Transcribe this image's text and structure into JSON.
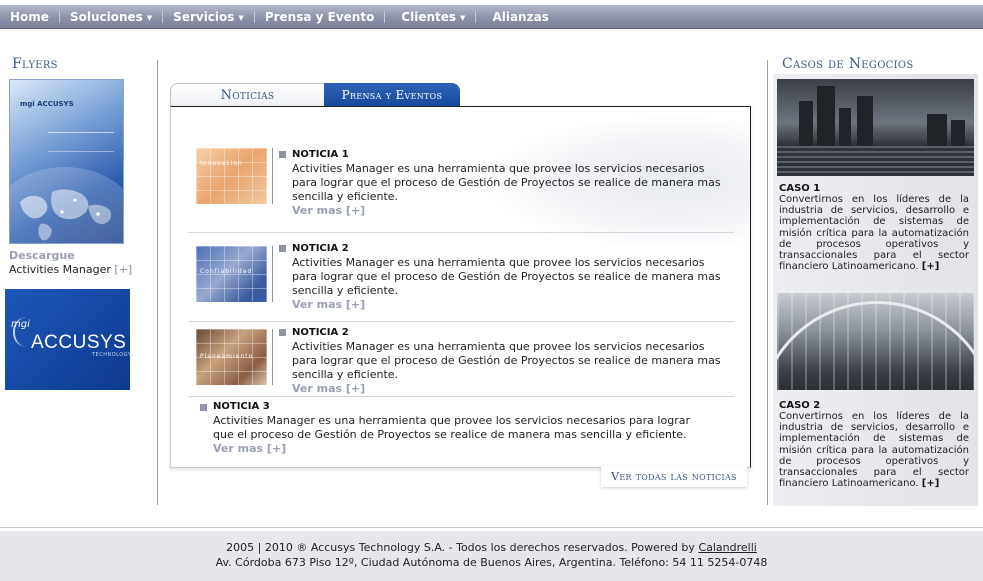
{
  "nav": {
    "items": [
      {
        "label": "Home",
        "dropdown": false
      },
      {
        "label": "Soluciones",
        "dropdown": true
      },
      {
        "label": "Servicios",
        "dropdown": true
      },
      {
        "label": "Prensa y Evento",
        "dropdown": false
      },
      {
        "label": "Clientes",
        "dropdown": true
      },
      {
        "label": "Alianzas",
        "dropdown": false
      }
    ]
  },
  "left": {
    "title": "Flyers",
    "flyer_logo": "mgi ACCUSYS",
    "download_label": "Descargue",
    "download_sub": "Activities Manager",
    "download_plus": "[+]",
    "logo": {
      "mgi": "mgi",
      "name": "ACCUSYS",
      "tech": "TECHNOLOGY"
    }
  },
  "tabs": {
    "noticias": "Noticias",
    "prensa": "Prensa y Eventos"
  },
  "news": [
    {
      "title": "NOTICIA 1",
      "text": "Activities Manager es una herramienta que provee los servicios necesarios para lograr que el proceso de Gestión de Proyectos se realice de manera mas sencilla y eficiente.",
      "more": "Ver mas [+]",
      "thumb_label": "Innovacion"
    },
    {
      "title": "NOTICIA 2",
      "text": "Activities Manager es una herramienta que provee los servicios necesarios para lograr que el proceso de Gestión de Proyectos se realice de manera mas sencilla y eficiente.",
      "more": "Ver mas [+]",
      "thumb_label": "Confiabilidad"
    },
    {
      "title": "NOTICIA 2",
      "text": "Activities Manager es una herramienta que provee los servicios necesarios para lograr que el proceso de Gestión de Proyectos se realice de manera mas sencilla y eficiente.",
      "more": "Ver mas [+]",
      "thumb_label": "Planeamiento"
    },
    {
      "title": "NOTICIA 3",
      "text": "Activities Manager es una herramienta que provee los servicios necesarios para lograr que el proceso de Gestión de Proyectos se realice de manera mas sencilla y eficiente.",
      "more": "Ver mas [+]"
    }
  ],
  "ver_todas": "Ver todas las noticias",
  "right": {
    "title": "Casos de Negocios",
    "cases": [
      {
        "title": "CASO 1",
        "text": "Convertirnos en los líderes de la industria de servicios, desarrollo e implementación de sistemas de misión crítica para la automatización de procesos operativos y transaccionales para el sector financiero Latinoamericano.",
        "more": "[+]"
      },
      {
        "title": "CASO 2",
        "text": "Convertirnos en los líderes de la industria de servicios, desarrollo e implementación de sistemas de misión crítica para la automatización de procesos operativos y transaccionales para el sector financiero Latinoamericano.",
        "more": "[+]"
      }
    ]
  },
  "footer": {
    "line1": "2005 | 2010 ® Accusys Technology S.A. - Todos los derechos reservados. Powered by",
    "credit": "Calandrelli",
    "line2": "Av. Córdoba 673 Piso 12º, Ciudad Autónoma de Buenos Aires, Argentina. Teléfono: 54 11 5254-0748"
  },
  "colors": {
    "nav_bg": "#8d92a8",
    "accent_blue": "#164a9b",
    "title_blue": "#3e5a8a",
    "muted_link": "#9aa0b3"
  }
}
